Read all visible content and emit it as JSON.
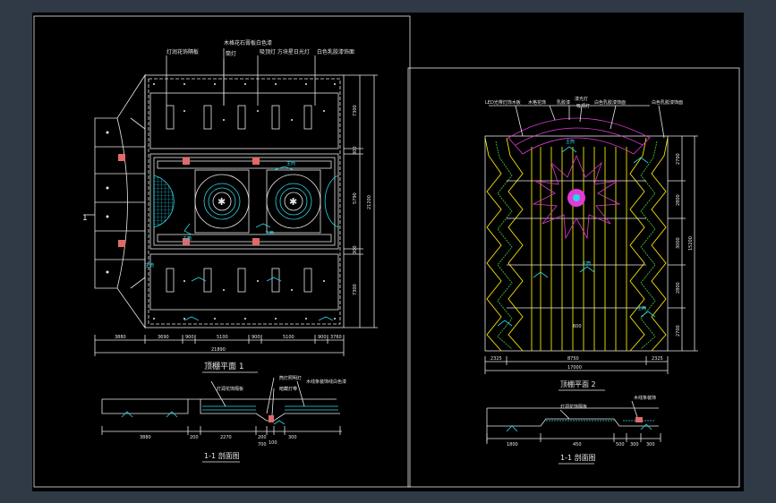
{
  "colors": {
    "background": "#2f3a46",
    "viewport": "#000000",
    "line_white": "#e8e8e8",
    "line_cyan": "#2ad6e8",
    "line_yellow": "#f5e600",
    "line_green": "#47d147",
    "line_magenta": "#e23ad7",
    "line_red": "#e23232"
  },
  "sheet1": {
    "callouts": [
      "灯润花饰隔板",
      "木格花石膏板白色漆",
      "筒灯",
      "吸顶灯 方块星日光灯",
      "白色乳胶漆饰面"
    ],
    "dims_right": [
      "7300",
      "300",
      "5790",
      "300",
      "7300",
      "21200"
    ],
    "dims_bottom": [
      "3880",
      "3690",
      "900",
      "5100",
      "900",
      "5100",
      "900",
      "3760"
    ],
    "dims_total": "21890",
    "section_mark": "1",
    "plan_title": "顶棚平面 1",
    "section_callouts": [
      "灯润花饰隔板",
      "筒灯照明灯",
      "暗藏灯带",
      "木线条装饰线白色漆"
    ],
    "section_dims": [
      "3880",
      "200",
      "2270",
      "200",
      "100",
      "300",
      "700"
    ],
    "section_title": "1-1 剖面图"
  },
  "sheet2": {
    "callouts": [
      "LED光带灯饰木板",
      "木格花饰",
      "乳胶漆",
      "漆光灯",
      "吸顶灯",
      "白色乳胶漆饰面",
      "白色乳胶漆饰面"
    ],
    "dims_right": [
      "2700",
      "2800",
      "3000",
      "2800",
      "2700",
      "15200"
    ],
    "dims_bottom": [
      "2325",
      "8750",
      "2325"
    ],
    "dims_total": "17000",
    "plan_title": "顶棚平面 2",
    "section_callouts": [
      "灯润花饰隔板",
      "木线条装饰"
    ],
    "section_dims": [
      "1800",
      "450",
      "500",
      "300",
      "300"
    ],
    "section_title": "1-1 剖面图"
  }
}
